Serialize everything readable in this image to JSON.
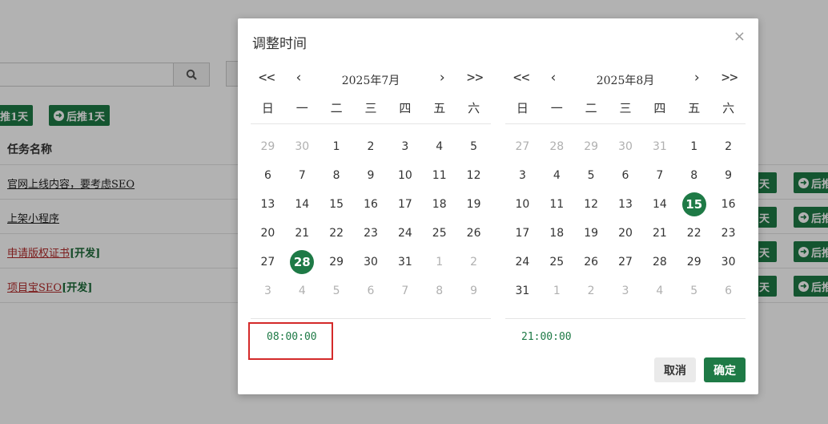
{
  "background": {
    "toolbar": {
      "postpone_back_label": "推1天",
      "postpone_forward_label": "后推1天"
    },
    "table": {
      "header": "任务名称",
      "rows": [
        {
          "name": "官网上线内容，要考虑SEO",
          "tag": ""
        },
        {
          "name": "上架小程序",
          "tag": ""
        },
        {
          "name": "申请版权证书",
          "tag": "[开发]"
        },
        {
          "name": "项目宝SEO",
          "tag": "[开发]"
        }
      ],
      "row_btn_back": "天",
      "row_btn_forward": "后推"
    }
  },
  "dialog": {
    "title": "调整时间",
    "close_glyph": "×",
    "weekdays": [
      "日",
      "一",
      "二",
      "三",
      "四",
      "五",
      "六"
    ],
    "nav": {
      "prev_year": "<<",
      "prev_month": "‹",
      "next_month": "›",
      "next_year": ">>"
    },
    "left_calendar": {
      "month_label": "2025年7月",
      "selected": "28",
      "time": "08:00:00",
      "days": [
        [
          "29",
          "m"
        ],
        [
          "30",
          "m"
        ],
        [
          "1",
          ""
        ],
        [
          "2",
          ""
        ],
        [
          "3",
          ""
        ],
        [
          "4",
          ""
        ],
        [
          "5",
          ""
        ],
        [
          "6",
          ""
        ],
        [
          "7",
          ""
        ],
        [
          "8",
          ""
        ],
        [
          "9",
          ""
        ],
        [
          "10",
          ""
        ],
        [
          "11",
          ""
        ],
        [
          "12",
          ""
        ],
        [
          "13",
          ""
        ],
        [
          "14",
          ""
        ],
        [
          "15",
          ""
        ],
        [
          "16",
          ""
        ],
        [
          "17",
          ""
        ],
        [
          "18",
          ""
        ],
        [
          "19",
          ""
        ],
        [
          "20",
          ""
        ],
        [
          "21",
          ""
        ],
        [
          "22",
          ""
        ],
        [
          "23",
          ""
        ],
        [
          "24",
          ""
        ],
        [
          "25",
          ""
        ],
        [
          "26",
          ""
        ],
        [
          "27",
          ""
        ],
        [
          "28",
          "s"
        ],
        [
          "29",
          ""
        ],
        [
          "30",
          ""
        ],
        [
          "31",
          ""
        ],
        [
          "1",
          "m"
        ],
        [
          "2",
          "m"
        ],
        [
          "3",
          "m"
        ],
        [
          "4",
          "m"
        ],
        [
          "5",
          "m"
        ],
        [
          "6",
          "m"
        ],
        [
          "7",
          "m"
        ],
        [
          "8",
          "m"
        ],
        [
          "9",
          "m"
        ]
      ]
    },
    "right_calendar": {
      "month_label": "2025年8月",
      "selected": "15",
      "time": "21:00:00",
      "days": [
        [
          "27",
          "m"
        ],
        [
          "28",
          "m"
        ],
        [
          "29",
          "m"
        ],
        [
          "30",
          "m"
        ],
        [
          "31",
          "m"
        ],
        [
          "1",
          ""
        ],
        [
          "2",
          ""
        ],
        [
          "3",
          ""
        ],
        [
          "4",
          ""
        ],
        [
          "5",
          ""
        ],
        [
          "6",
          ""
        ],
        [
          "7",
          ""
        ],
        [
          "8",
          ""
        ],
        [
          "9",
          ""
        ],
        [
          "10",
          ""
        ],
        [
          "11",
          ""
        ],
        [
          "12",
          ""
        ],
        [
          "13",
          ""
        ],
        [
          "14",
          ""
        ],
        [
          "15",
          "s"
        ],
        [
          "16",
          ""
        ],
        [
          "17",
          ""
        ],
        [
          "18",
          ""
        ],
        [
          "19",
          ""
        ],
        [
          "20",
          ""
        ],
        [
          "21",
          ""
        ],
        [
          "22",
          ""
        ],
        [
          "23",
          ""
        ],
        [
          "24",
          ""
        ],
        [
          "25",
          ""
        ],
        [
          "26",
          ""
        ],
        [
          "27",
          ""
        ],
        [
          "28",
          ""
        ],
        [
          "29",
          ""
        ],
        [
          "30",
          ""
        ],
        [
          "31",
          ""
        ],
        [
          "1",
          "m"
        ],
        [
          "2",
          "m"
        ],
        [
          "3",
          "m"
        ],
        [
          "4",
          "m"
        ],
        [
          "5",
          "m"
        ],
        [
          "6",
          "m"
        ]
      ]
    },
    "buttons": {
      "cancel": "取消",
      "confirm": "确定"
    }
  },
  "colors": {
    "accent": "#1e7a46",
    "highlight_box": "#d42a2a",
    "muted_day": "#b0b0b0"
  }
}
